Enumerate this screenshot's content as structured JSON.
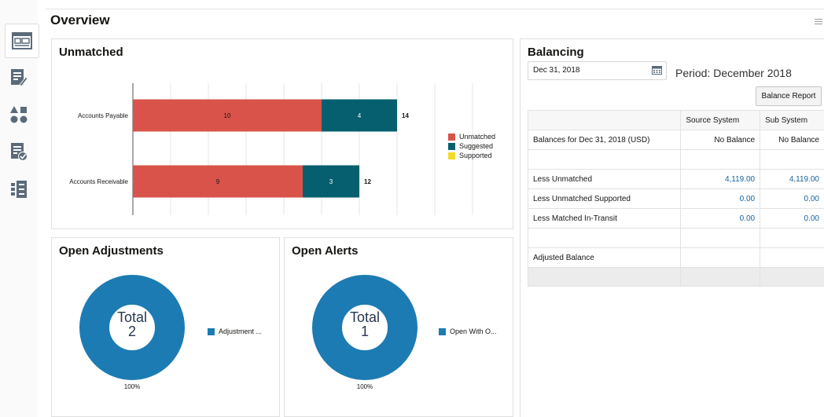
{
  "page": {
    "title": "Overview"
  },
  "rail": [
    {
      "name": "dashboard-icon",
      "active": true
    },
    {
      "name": "edit-list-icon"
    },
    {
      "name": "shapes-icon"
    },
    {
      "name": "checked-list-icon"
    },
    {
      "name": "list-details-icon"
    }
  ],
  "unmatched": {
    "title": "Unmatched",
    "legend": [
      {
        "label": "Unmatched",
        "color": "#d9534a"
      },
      {
        "label": "Suggested",
        "color": "#065f6e"
      },
      {
        "label": "Supported",
        "color": "#f2dc2a"
      }
    ]
  },
  "chart_data": {
    "type": "bar",
    "orientation": "horizontal",
    "stacked": true,
    "categories": [
      "Accounts Payable",
      "Accounts Receivable"
    ],
    "series": [
      {
        "name": "Unmatched",
        "values": [
          10,
          9
        ],
        "color": "#d9534a"
      },
      {
        "name": "Suggested",
        "values": [
          4,
          3
        ],
        "color": "#065f6e"
      },
      {
        "name": "Supported",
        "values": [
          0,
          0
        ],
        "color": "#f2dc2a"
      }
    ],
    "totals": [
      "14",
      "12"
    ],
    "xlim": [
      0,
      18
    ],
    "grid": true,
    "legend": "right"
  },
  "adjustments": {
    "title": "Open Adjustments",
    "total_label": "Total",
    "total_value": "2",
    "percent": "100%",
    "legend_label": "Adjustment ...",
    "color": "#1d7bb3"
  },
  "alerts": {
    "title": "Open Alerts",
    "total_label": "Total",
    "total_value": "1",
    "percent": "100%",
    "legend_label": "Open With O...",
    "color": "#1d7bb3"
  },
  "balancing": {
    "title": "Balancing",
    "date": "Dec 31, 2018",
    "period": "Period: December 2018",
    "report_button": "Balance Report",
    "columns": [
      "",
      "Source System",
      "Sub System"
    ],
    "rows": [
      {
        "label": "Balances for Dec 31, 2018 (USD)",
        "source": "No Balance",
        "sub": "No Balance",
        "link": false
      },
      {
        "label": "",
        "source": "",
        "sub": "",
        "link": false
      },
      {
        "label": "Less Unmatched",
        "source": "4,119.00",
        "sub": "4,119.00",
        "link": true
      },
      {
        "label": "Less Unmatched Supported",
        "source": "0.00",
        "sub": "0.00",
        "link": true
      },
      {
        "label": "Less Matched In-Transit",
        "source": "0.00",
        "sub": "0.00",
        "link": true
      },
      {
        "label": "",
        "source": "",
        "sub": "",
        "link": false
      },
      {
        "label": "Adjusted Balance",
        "source": "",
        "sub": "",
        "link": false
      }
    ]
  }
}
